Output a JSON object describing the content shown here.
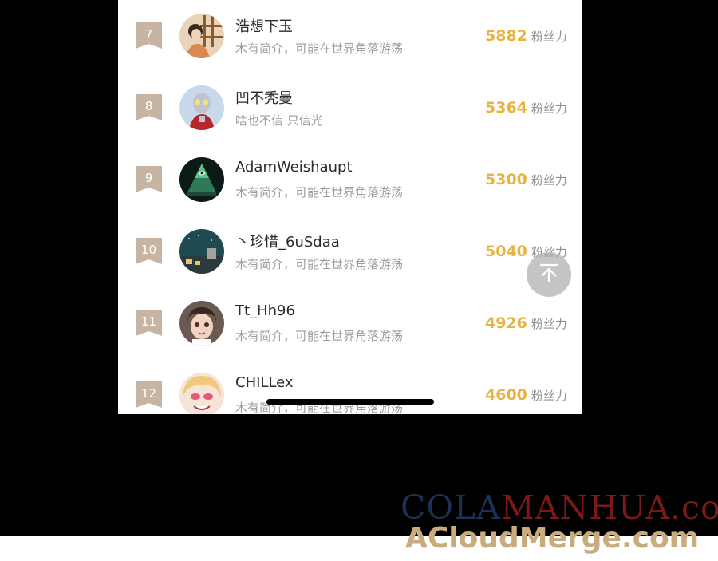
{
  "ranking": {
    "score_unit": "粉丝力",
    "entries": [
      {
        "rank": "7",
        "name": "浩想下玉",
        "bio": "木有简介，可能在世界角落游荡",
        "score": "5882"
      },
      {
        "rank": "8",
        "name": "凹不秃曼",
        "bio": "啥也不信 只信光",
        "score": "5364"
      },
      {
        "rank": "9",
        "name": "AdamWeishaupt",
        "bio": "木有简介，可能在世界角落游荡",
        "score": "5300"
      },
      {
        "rank": "10",
        "name": "丶珍惜_6uSdaa",
        "bio": "木有简介，可能在世界角落游荡",
        "score": "5040"
      },
      {
        "rank": "11",
        "name": "Tt_Hh96",
        "bio": "木有简介，可能在世界角落游荡",
        "score": "4926"
      },
      {
        "rank": "12",
        "name": "CHILLex",
        "bio": "木有简介，可能在世界角落游荡",
        "score": "4600"
      }
    ]
  },
  "icons": {
    "scroll_top": "arrow-up-to-top-icon",
    "badge": "rank-ribbon-icon"
  },
  "colors": {
    "score": "#e9b343",
    "badge": "#c6b5a3",
    "name": "#2b2b2b",
    "bio": "#9d9d9d"
  },
  "watermark": {
    "line1_part1": "COLA",
    "line1_part2": "MANHUA.com",
    "line2": "ACloudMerge.com"
  }
}
